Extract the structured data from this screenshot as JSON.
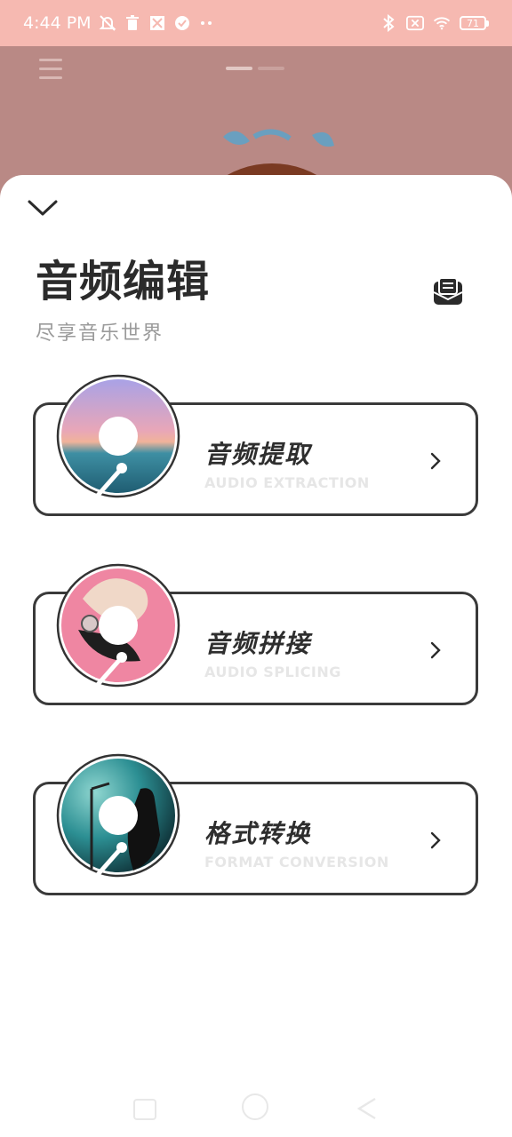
{
  "status_bar": {
    "time": "4:44 PM",
    "icons_left": [
      "mute-icon",
      "trash-icon",
      "app-icon",
      "check-icon",
      "more-dots-icon"
    ],
    "icons_right": [
      "bluetooth-icon",
      "sim-icon",
      "wifi-icon"
    ],
    "battery": "71"
  },
  "sheet": {
    "title": "音频编辑",
    "subtitle": "尽享音乐世界",
    "cards": [
      {
        "title": "音频提取",
        "subtitle": "AUDIO EXTRACTION"
      },
      {
        "title": "音频拼接",
        "subtitle": "AUDIO SPLICING"
      },
      {
        "title": "格式转换",
        "subtitle": "FORMAT CONVERSION"
      }
    ]
  },
  "colors": {
    "status_bar": "#f6b9b1",
    "background_header": "#b98985",
    "card_border": "#3a3a3a",
    "title": "#2b2b2b"
  }
}
